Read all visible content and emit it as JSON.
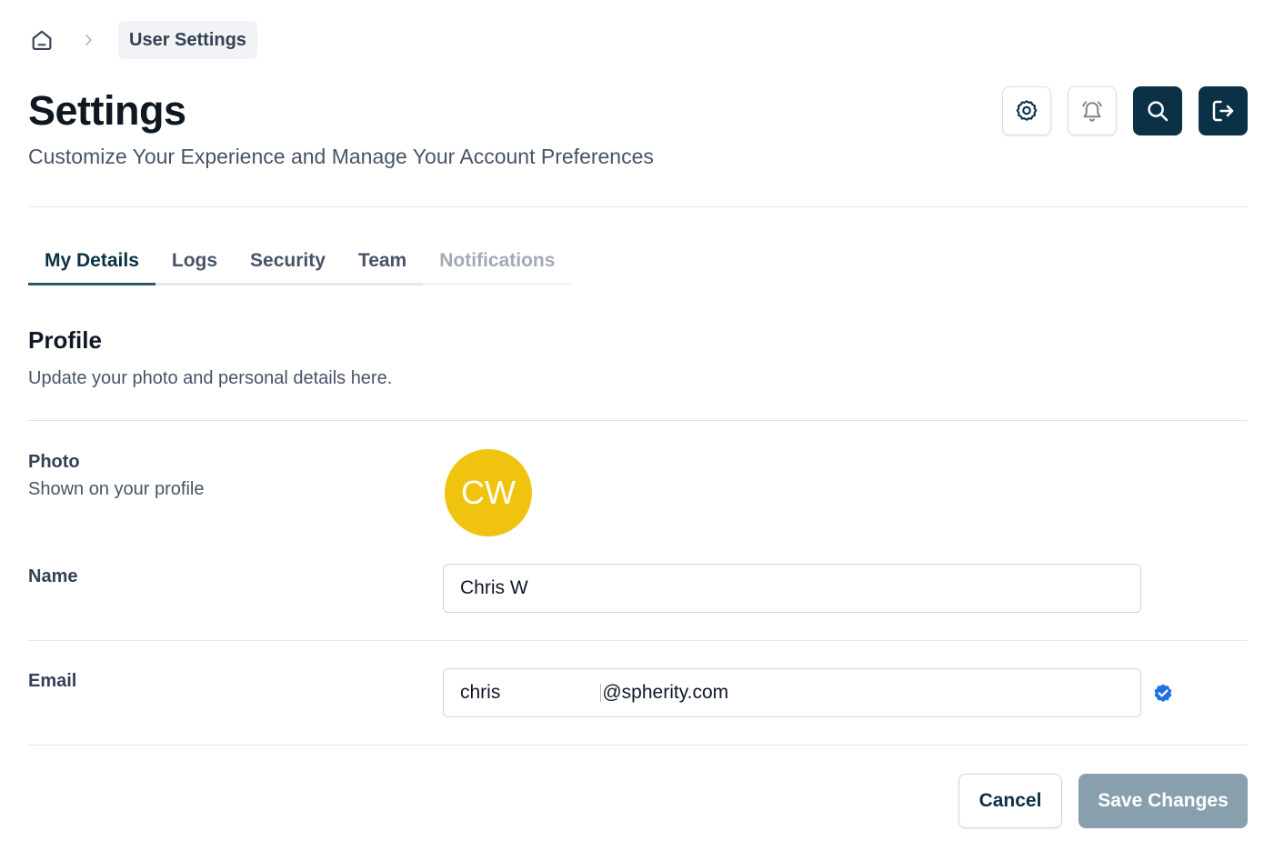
{
  "breadcrumb": {
    "current": "User Settings"
  },
  "header": {
    "title": "Settings",
    "subtitle": "Customize Your Experience and Manage Your Account Preferences"
  },
  "tabs": [
    {
      "label": "My Details",
      "state": "active"
    },
    {
      "label": "Logs",
      "state": "default"
    },
    {
      "label": "Security",
      "state": "default"
    },
    {
      "label": "Team",
      "state": "default"
    },
    {
      "label": "Notifications",
      "state": "disabled"
    }
  ],
  "profile": {
    "title": "Profile",
    "description": "Update your photo and personal details here.",
    "photo": {
      "label": "Photo",
      "sublabel": "Shown on your profile",
      "initials": "CW",
      "color": "#f0c30f"
    },
    "name": {
      "label": "Name",
      "value": "Chris W"
    },
    "email": {
      "label": "Email",
      "value_start": "chris",
      "value_end": "@spherity.com",
      "verified": true
    }
  },
  "actions": {
    "cancel_label": "Cancel",
    "save_label": "Save Changes"
  },
  "colors": {
    "primary_dark": "#0a3146",
    "save_disabled": "#88a0ae",
    "verified_badge": "#1f6fe5"
  }
}
